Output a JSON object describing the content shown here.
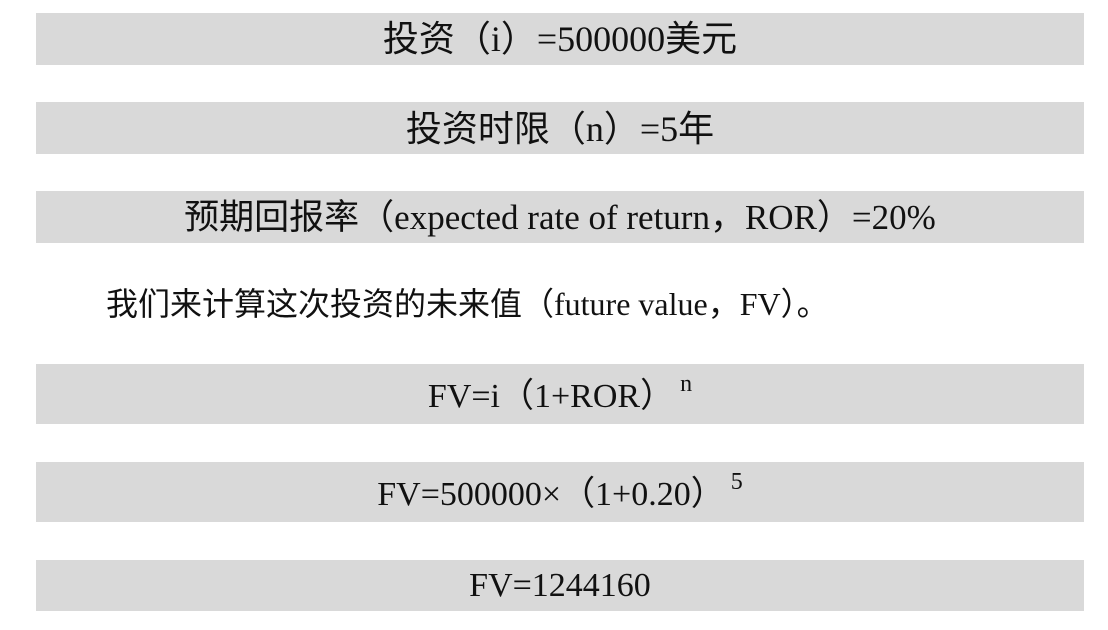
{
  "lines": {
    "investment": "投资（i）=500000美元",
    "horizon": "投资时限（n）=5年",
    "ror": "预期回报率（expected rate of return，ROR）=20%",
    "intro": "我们来计算这次投资的未来值（future value，FV）。"
  },
  "formulas": {
    "general": {
      "base": "FV=i（1+ROR）",
      "exponent": "n"
    },
    "substituted": {
      "base": "FV=500000×（1+0.20）",
      "exponent": "5"
    },
    "result": "FV=1244160"
  }
}
